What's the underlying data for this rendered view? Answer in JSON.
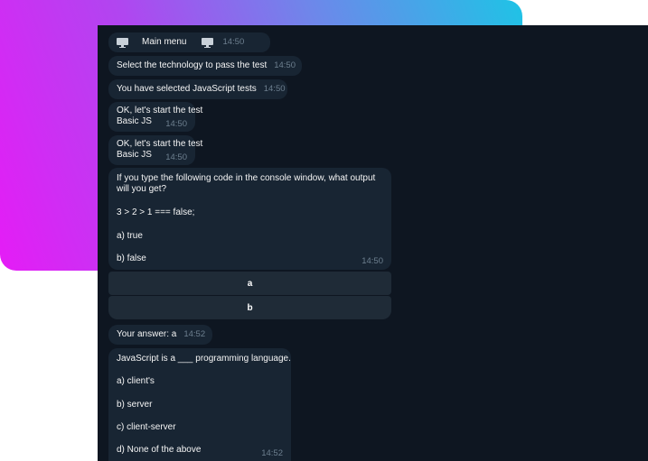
{
  "messages": {
    "main_menu": {
      "icon": "monitor-icon",
      "label": "Main menu",
      "time": "14:50"
    },
    "select_tech": {
      "text": "Select the technology to pass the test",
      "time": "14:50"
    },
    "selected": {
      "text": "You have selected JavaScript tests",
      "time": "14:50"
    },
    "start_1": {
      "line1": "OK, let's start the test",
      "line2": "Basic JS",
      "time": "14:50"
    },
    "start_2": {
      "line1": "OK, let's start the test",
      "line2": "Basic JS",
      "time": "14:50"
    },
    "question_1": {
      "line1": "If you type the following code in the console window, what output",
      "line2": "will you get?",
      "code": "3 > 2 > 1 === false;",
      "option_a": "a) true",
      "option_b": "b) false",
      "time": "14:50"
    },
    "keyboard": {
      "button_a": "a",
      "button_b": "b"
    },
    "your_answer": {
      "text": "Your answer: a",
      "time": "14:52"
    },
    "question_2": {
      "text": "JavaScript is a ___ programming language.",
      "option_a": "a) client's",
      "option_b": "b) server",
      "option_c": "c) client-server",
      "option_d": "d) None of the above",
      "time": "14:52"
    }
  }
}
